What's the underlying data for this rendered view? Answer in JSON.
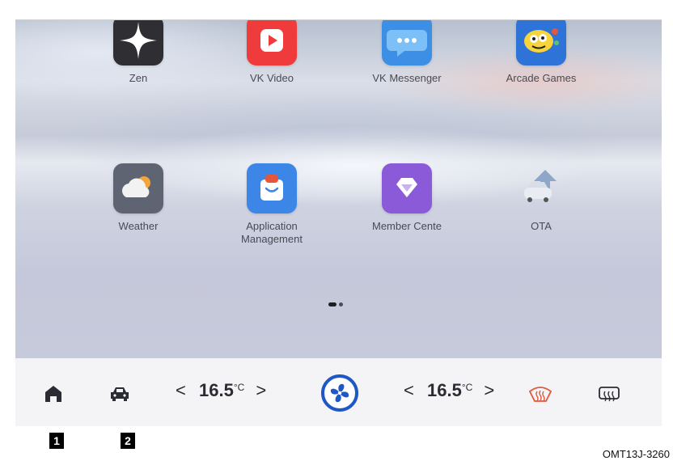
{
  "apps": [
    {
      "label": "Zen",
      "icon": "zen-icon"
    },
    {
      "label": "VK Video",
      "icon": "vk-video-icon"
    },
    {
      "label": "VK Messenger",
      "icon": "vk-messenger-icon"
    },
    {
      "label": "Arcade Games",
      "icon": "arcade-games-icon"
    },
    {
      "label": "Weather",
      "icon": "weather-icon"
    },
    {
      "label": "Application\nManagement",
      "icon": "app-management-icon"
    },
    {
      "label": "Member Cente",
      "icon": "member-center-icon"
    },
    {
      "label": "OTA",
      "icon": "ota-icon"
    }
  ],
  "pager": {
    "pages": 2,
    "current": 1
  },
  "dock": {
    "home_icon": "home-icon",
    "car_icon": "car-icon",
    "left_temp": {
      "value": "16.5",
      "unit": "°C",
      "decrease": "<",
      "increase": ">"
    },
    "fan_icon": "fan-icon",
    "right_temp": {
      "value": "16.5",
      "unit": "°C",
      "decrease": "<",
      "increase": ">"
    },
    "front_defrost_icon": "front-defrost-icon",
    "rear_defrost_icon": "rear-defrost-icon"
  },
  "markers": [
    "1",
    "2"
  ],
  "figure_code": "OMT13J-3260",
  "colors": {
    "dock_bg": "#f4f4f6",
    "fan_accent": "#1f57c6",
    "defrost_front": "#e4573a",
    "text": "#2b2b33"
  }
}
